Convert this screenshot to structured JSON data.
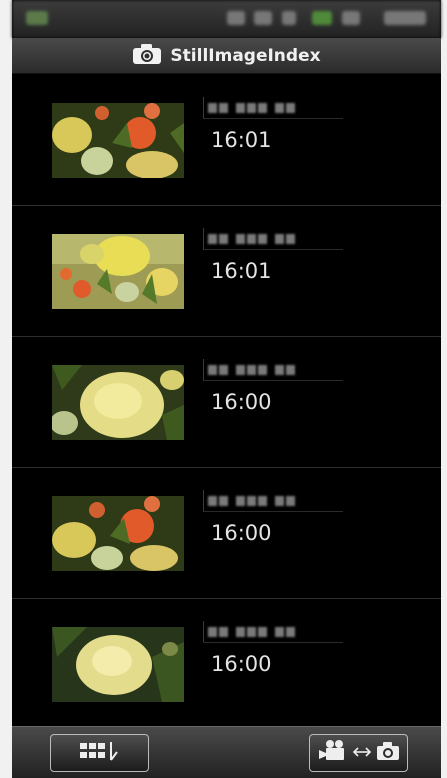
{
  "app": {
    "title": "StillImageIndex",
    "title_icon": "camera-icon"
  },
  "items": [
    {
      "time": "16:01",
      "thumbnail": "orange-yellow-flowers"
    },
    {
      "time": "16:01",
      "thumbnail": "yellow-rose-orange-flowers"
    },
    {
      "time": "16:00",
      "thumbnail": "yellow-rose-closeup"
    },
    {
      "time": "16:00",
      "thumbnail": "orange-yellow-flowers"
    },
    {
      "time": "16:00",
      "thumbnail": "yellow-rose-closeup"
    }
  ],
  "toolbar": {
    "left_button_icon": "thumbnail-grid-sort-icon",
    "right_button_icon": "video-to-photo-switch-icon"
  }
}
